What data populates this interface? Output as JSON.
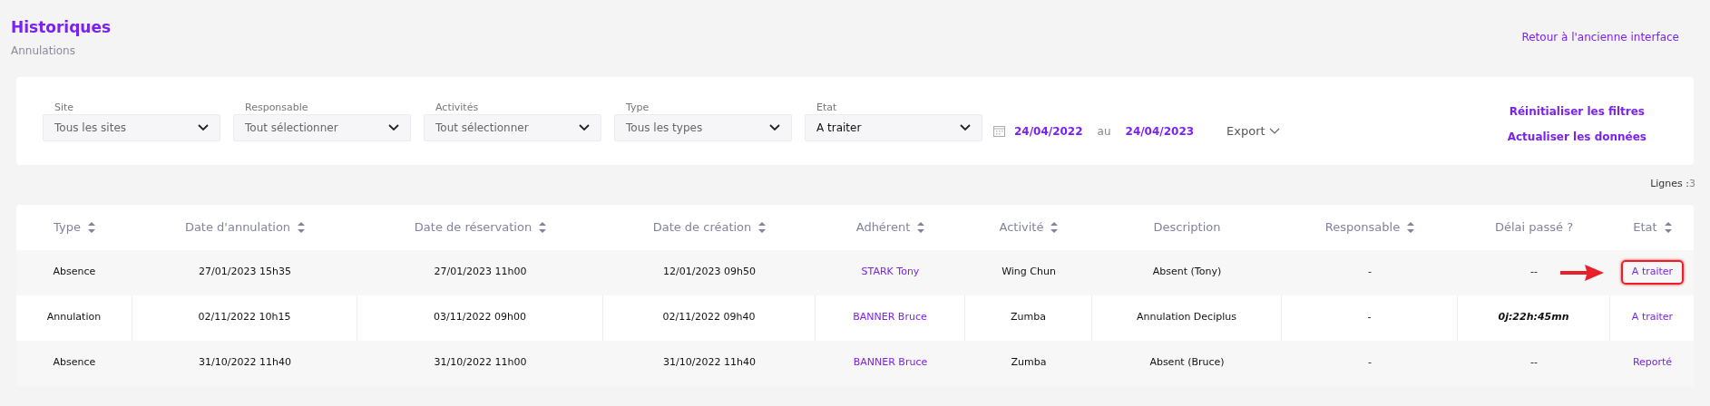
{
  "header": {
    "title": "Historiques",
    "subtitle": "Annulations",
    "back_link": "Retour à l'ancienne interface"
  },
  "filters": [
    {
      "label": "Site",
      "value": "Tous les sites",
      "is_default": true
    },
    {
      "label": "Responsable",
      "value": "Tout sélectionner",
      "is_default": true
    },
    {
      "label": "Activités",
      "value": "Tout sélectionner",
      "is_default": true
    },
    {
      "label": "Type",
      "value": "Tous les types",
      "is_default": true
    },
    {
      "label": "Etat",
      "value": "A traiter",
      "is_default": false
    }
  ],
  "date_range": {
    "from": "24/04/2022",
    "separator": "au",
    "to": "24/04/2023"
  },
  "export": "Export",
  "actions": [
    "Réinitialiser les filtres",
    "Actualiser les données"
  ],
  "row_count": {
    "label": "Lignes :",
    "value": "3"
  },
  "table": {
    "columns": [
      {
        "label": "Type",
        "sortable": true
      },
      {
        "label": "Date d'annulation",
        "sortable": true
      },
      {
        "label": "Date de réservation",
        "sortable": true
      },
      {
        "label": "Date de création",
        "sortable": true
      },
      {
        "label": "Adhérent",
        "sortable": true
      },
      {
        "label": "Activité",
        "sortable": true
      },
      {
        "label": "Description",
        "sortable": false
      },
      {
        "label": "Responsable",
        "sortable": true
      },
      {
        "label": "Délai passé ?",
        "sortable": false
      },
      {
        "label": "Etat",
        "sortable": true
      }
    ],
    "rows": [
      {
        "type": "Absence",
        "date_annulation": "27/01/2023 15h35",
        "date_reservation": "27/01/2023 11h00",
        "date_creation": "12/01/2023 09h50",
        "adherent": "STARK Tony",
        "activite": "Wing Chun",
        "description": "Absent (Tony)",
        "responsable": "-",
        "delai": "--",
        "delai_emphasis": false,
        "etat": "A traiter",
        "highlighted": true
      },
      {
        "type": "Annulation",
        "date_annulation": "02/11/2022 10h15",
        "date_reservation": "03/11/2022 09h00",
        "date_creation": "02/11/2022 09h40",
        "adherent": "BANNER Bruce",
        "activite": "Zumba",
        "description": "Annulation Deciplus",
        "responsable": "-",
        "delai": "0j:22h:45mn",
        "delai_emphasis": true,
        "etat": "A traiter",
        "highlighted": false
      },
      {
        "type": "Absence",
        "date_annulation": "31/10/2022 11h40",
        "date_reservation": "31/10/2022 11h00",
        "date_creation": "31/10/2022 11h40",
        "adherent": "BANNER Bruce",
        "activite": "Zumba",
        "description": "Absent (Bruce)",
        "responsable": "-",
        "delai": "--",
        "delai_emphasis": false,
        "etat": "Reporté",
        "highlighted": false
      }
    ]
  }
}
